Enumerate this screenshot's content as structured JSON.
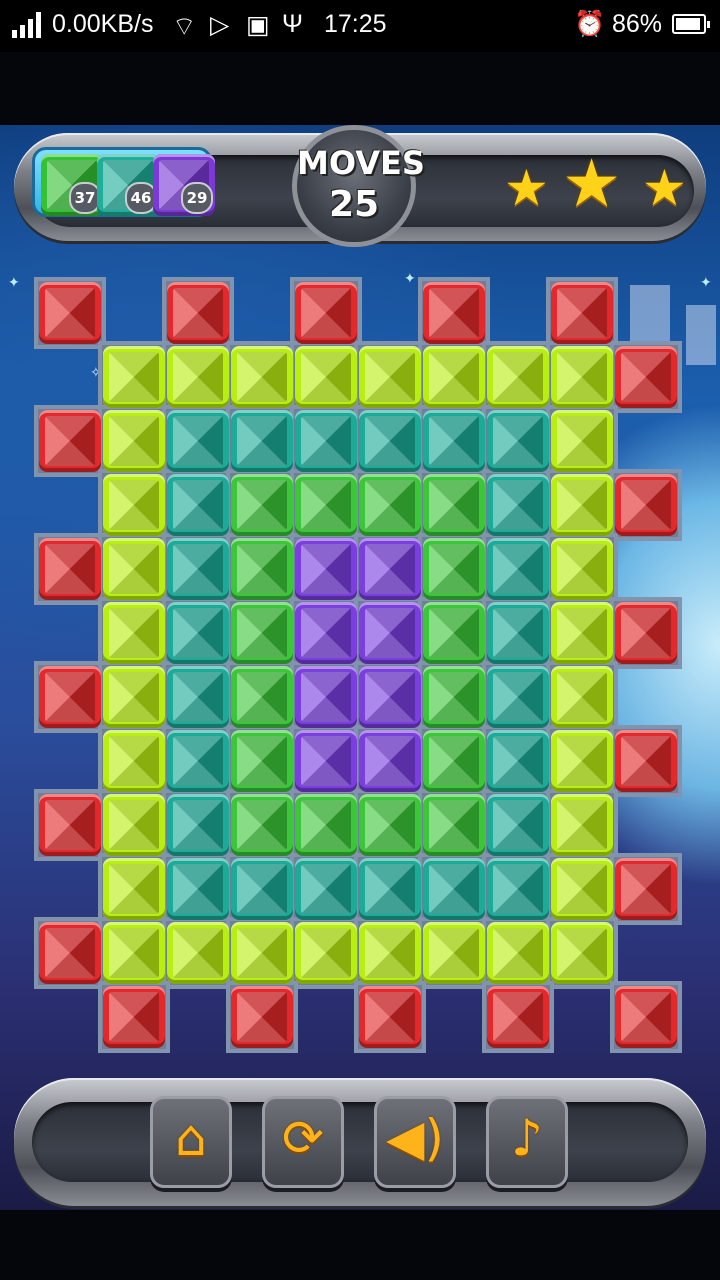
{
  "status_bar": {
    "net_speed": "0.00KB/s",
    "time": "17:25",
    "battery_percent": "86%",
    "icons": [
      "signal-icon",
      "wifi-icon",
      "play-store-icon",
      "gallery-icon",
      "usb-icon",
      "alarm-icon",
      "battery-icon"
    ]
  },
  "hud": {
    "goals": [
      {
        "color": "#34c234",
        "count": "37"
      },
      {
        "color": "#1fae9a",
        "count": "46"
      },
      {
        "color": "#7b3ad6",
        "count": "29"
      }
    ],
    "moves_label": "MOVES",
    "moves_value": "25",
    "stars_earned": 3,
    "stars_total": 3
  },
  "board": {
    "cols": 10,
    "rows": 12,
    "palette": {
      "R": "#e3292b",
      "Y": "#b9ee12",
      "T": "#1cab98",
      "G": "#3cc63a",
      "P": "#7b3fe0"
    },
    "grid": [
      "R.R.R.R.R.",
      ".YYYYYYYYR",
      "RYTTTTTTY.",
      ".YTGGGGTYR",
      "RYTGPPGTY.",
      ".YTGPPGTYR",
      "RYTGPPGTY.",
      ".YTGPPGTYR",
      "RYTGGGGTY.",
      ".YTTTTTTYR",
      "RYYYYYYYY.",
      ".R.R.R.R.R"
    ]
  },
  "controls": {
    "buttons": [
      {
        "name": "home-button",
        "icon": "home-icon"
      },
      {
        "name": "restart-button",
        "icon": "refresh-icon"
      },
      {
        "name": "sound-button",
        "icon": "speaker-icon"
      },
      {
        "name": "music-button",
        "icon": "music-note-icon"
      }
    ]
  },
  "colors": {
    "hud_star": "#ffd21a",
    "control_icon": "#ffb31a"
  }
}
